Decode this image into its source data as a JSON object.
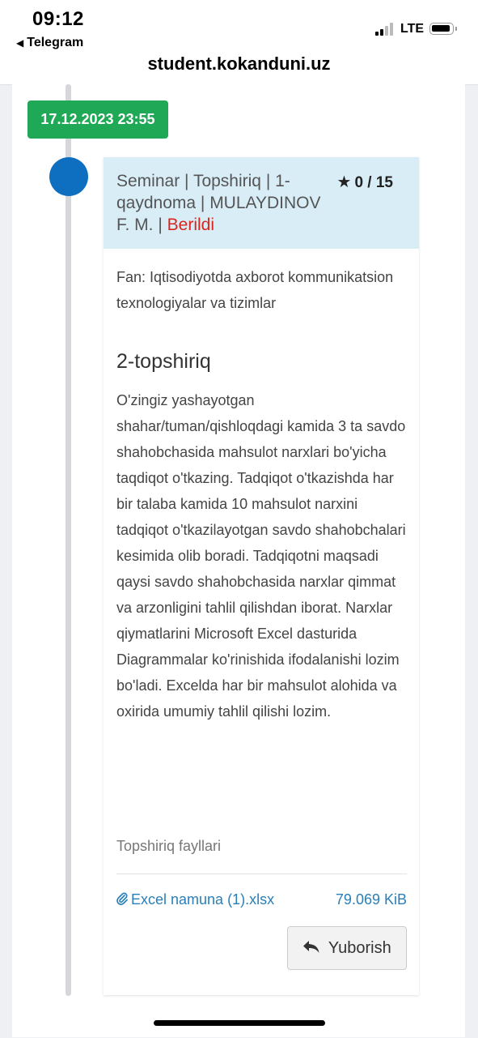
{
  "status_bar": {
    "time": "09:12",
    "back_app": "Telegram",
    "back_icon": "back-triangle-icon",
    "network": "LTE",
    "signal_icon": "signal-bars-icon",
    "battery_icon": "battery-icon"
  },
  "browser": {
    "url": "student.kokanduni.uz"
  },
  "timeline": {
    "date": "17.12.2023 23:55",
    "date_color": "#1fa855",
    "dot_color": "#0e6fc0"
  },
  "card": {
    "title": "Seminar | Topshiriq | 1-qaydnoma | MULAYDINOV F. M. |",
    "status": "Berildi",
    "status_color": "#d9251c",
    "score_icon": "star-icon",
    "score": "0 / 15",
    "subject": "Fan: Iqtisodiyotda axborot kommunikatsion texnologiyalar va tizimlar",
    "task_title": "2-topshiriq",
    "task_text": "O'zingiz yashayotgan shahar/tuman/qishloqdagi kamida 3 ta savdo shahobchasida mahsulot narxlari bo'yicha taqdiqot o'tkazing. Tadqiqot o'tkazishda har bir talaba kamida 10 mahsulot narxini tadqiqot o'tkazilayotgan savdo shahobchalari kesimida olib boradi. Tadqiqotni maqsadi qaysi savdo shahobchasida narxlar qimmat va arzonligini tahlil qilishdan iborat. Narxlar qiymatlarini Microsoft Excel dasturida Diagrammalar ko'rinishida ifodalanishi lozim bo'ladi. Excelda har bir mahsulot alohida va oxirida umumiy tahlil qilishi lozim.",
    "files_label": "Topshiriq fayllari",
    "file": {
      "icon": "paperclip-icon",
      "name": "Excel namuna (1).xlsx",
      "size": "79.069 KiB"
    },
    "submit": {
      "icon": "reply-icon",
      "label": "Yuborish"
    }
  }
}
